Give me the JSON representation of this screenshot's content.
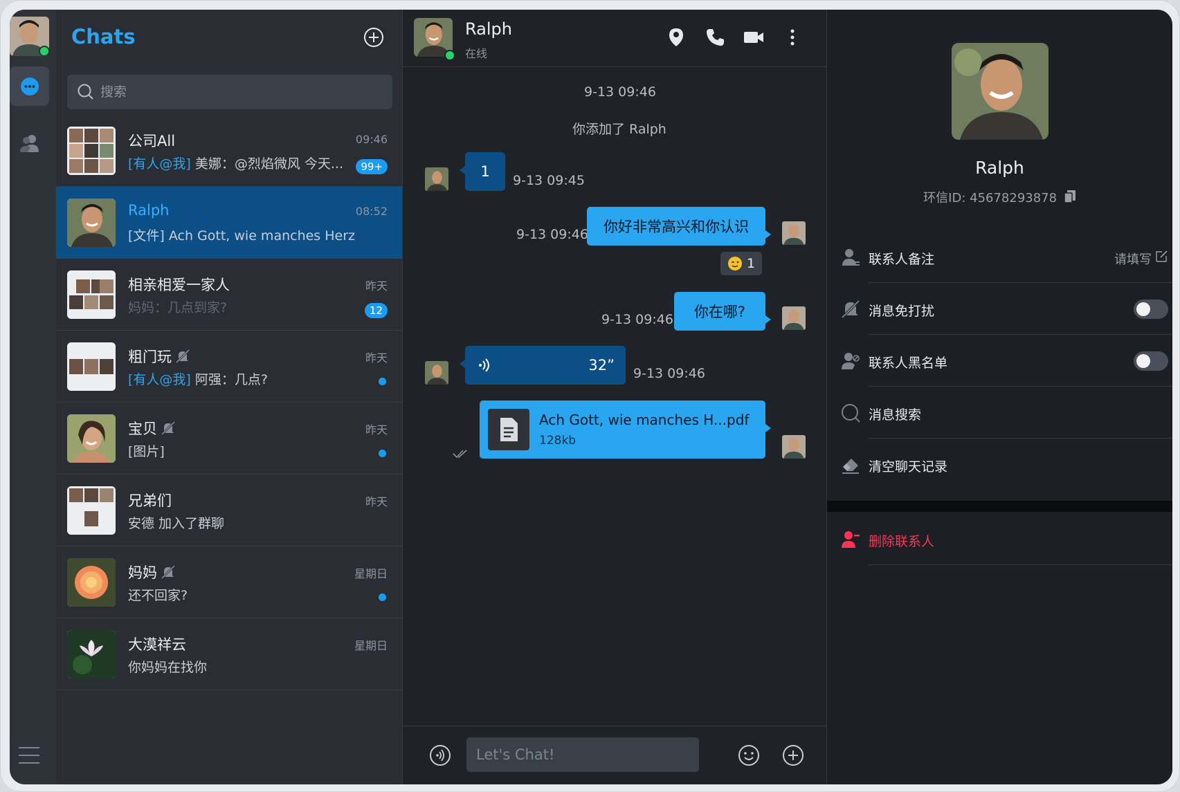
{
  "sidebar": {
    "active": "chats"
  },
  "chat_list": {
    "title": "Chats",
    "search_placeholder": "搜索",
    "items": [
      {
        "name": "公司All",
        "mention": "[有人@我]",
        "preview": "美娜：@烈焰微风 今天...",
        "time": "09:46",
        "badge": "99+",
        "muted": false
      },
      {
        "name": "Ralph",
        "mention": "",
        "preview": "[文件] Ach Gott, wie manches Herz...",
        "time": "08:52",
        "badge": "",
        "muted": false
      },
      {
        "name": "相亲相爱一家人",
        "mention": "",
        "preview": "妈妈：几点到家?",
        "time": "昨天",
        "badge": "12",
        "muted": false
      },
      {
        "name": "粗门玩",
        "mention": "[有人@我]",
        "preview": "阿强：几点?",
        "time": "昨天",
        "badge": "",
        "muted": true
      },
      {
        "name": "宝贝",
        "mention": "",
        "preview": "[图片]",
        "time": "昨天",
        "badge": "",
        "muted": true
      },
      {
        "name": "兄弟们",
        "mention": "",
        "preview": "安德 加入了群聊",
        "time": "昨天",
        "badge": "",
        "muted": false
      },
      {
        "name": "妈妈",
        "mention": "",
        "preview": "还不回家?",
        "time": "星期日",
        "badge": "",
        "muted": true
      },
      {
        "name": "大漠祥云",
        "mention": "",
        "preview": "你妈妈在找你",
        "time": "星期日",
        "badge": "",
        "muted": false
      }
    ]
  },
  "conversation": {
    "contact_name": "Ralph",
    "status": "在线",
    "system_time": "9-13 09:46",
    "system_msg": "你添加了 Ralph",
    "messages": [
      {
        "dir": "in",
        "text": "1",
        "time": "9-13 09:45"
      },
      {
        "dir": "out",
        "text": "你好非常高兴和你认识",
        "time": "9-13 09:46",
        "reaction": "1"
      },
      {
        "dir": "out",
        "text": "你在哪?",
        "time": "9-13 09:46"
      },
      {
        "dir": "in",
        "type": "voice",
        "duration": "32”",
        "time": "9-13 09:46"
      },
      {
        "dir": "out",
        "type": "file",
        "filename": "Ach Gott, wie manches H...pdf",
        "size": "128kb"
      }
    ],
    "composer_placeholder": "Let's Chat!"
  },
  "profile": {
    "name": "Ralph",
    "id_text": "环信ID: 45678293878",
    "rows": {
      "remark_label": "联系人备注",
      "remark_value": "请填写",
      "mute_label": "消息免打扰",
      "blacklist_label": "联系人黑名单",
      "search_label": "消息搜索",
      "clear_label": "清空聊天记录",
      "delete_label": "删除联系人"
    }
  }
}
